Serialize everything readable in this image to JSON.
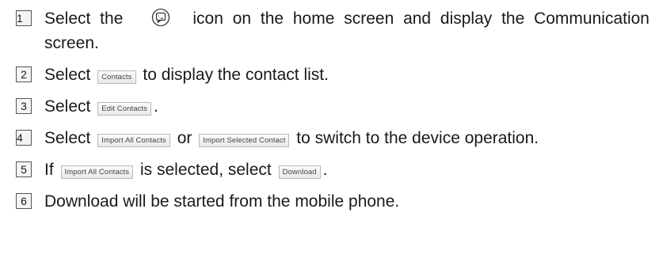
{
  "steps": [
    {
      "number": "1",
      "text_a": "Select the",
      "icon": "phone-icon",
      "text_b": "icon on the home screen and display the Communication screen."
    },
    {
      "number": "2",
      "text_a": "Select",
      "button": "Contacts",
      "text_b": "to display the contact list."
    },
    {
      "number": "3",
      "text_a": "Select",
      "button": "Edit Contacts",
      "text_b": "."
    },
    {
      "number": "4",
      "text_a": "Select",
      "button_1": "Import All Contacts",
      "text_or": "or",
      "button_2": "Import Selected Contact",
      "text_b": "to switch to the device operation."
    },
    {
      "number": "5",
      "text_a": "If",
      "button_1": "Import All Contacts",
      "text_mid": "is selected, select",
      "button_2": "Download",
      "text_b": "."
    },
    {
      "number": "6",
      "text_a": "Download will be started from the mobile phone."
    }
  ]
}
